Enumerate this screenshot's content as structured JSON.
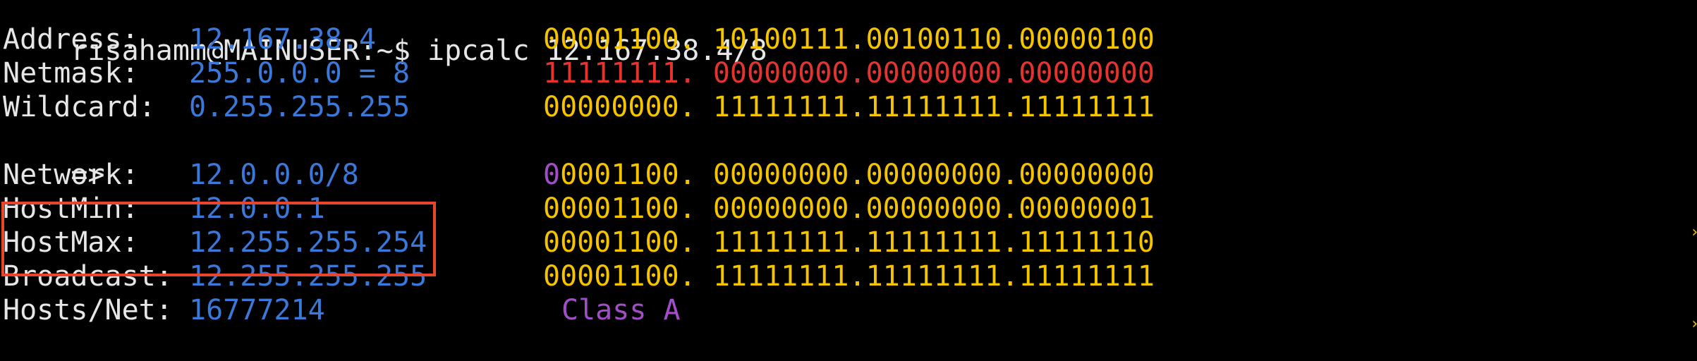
{
  "terminal": {
    "prompt_user": "risahamm@MAINUSER:~$",
    "command": " ipcalc 12.167.38.4/8",
    "rows": {
      "address": {
        "label": "Address:",
        "value": "12.167.38.4",
        "bin_octet1": "00001100.",
        "bin_rest": "10100111.00100110.00000100"
      },
      "netmask": {
        "label": "Netmask:",
        "value": "255.0.0.0 = 8",
        "bin_octet1": "11111111.",
        "bin_rest": "00000000.00000000.00000000"
      },
      "wildcard": {
        "label": "Wildcard:",
        "value": "0.255.255.255",
        "bin_octet1": "00000000.",
        "bin_rest": "11111111.11111111.11111111"
      },
      "arrow": "=>",
      "network": {
        "label": "Network:",
        "value": "12.0.0.0/8",
        "bin_class_bit": "0",
        "bin_octet1_rest": "0001100.",
        "bin_rest": "00000000.00000000.00000000"
      },
      "hostmin": {
        "label": "HostMin:",
        "value": "12.0.0.1",
        "bin_octet1": "00001100.",
        "bin_rest": "00000000.00000000.00000001"
      },
      "hostmax": {
        "label": "HostMax:",
        "value": "12.255.255.254",
        "bin_octet1": "00001100.",
        "bin_rest": "11111111.11111111.11111110"
      },
      "broadcast": {
        "label": "Broadcast:",
        "value": "12.255.255.255",
        "bin_octet1": "00001100.",
        "bin_rest": "11111111.11111111.11111111"
      },
      "hosts": {
        "label": "Hosts/Net:",
        "value": "16777214",
        "class": "Class A"
      }
    },
    "scroll_marker_glyph": "›",
    "colors": {
      "background": "#000000",
      "text": "#e6e6e6",
      "value_blue": "#3b78d8",
      "binary_yellow": "#f5c400",
      "netmask_red": "#e3342f",
      "class_purple": "#a24ec9",
      "highlight_red": "#e8452c"
    }
  }
}
